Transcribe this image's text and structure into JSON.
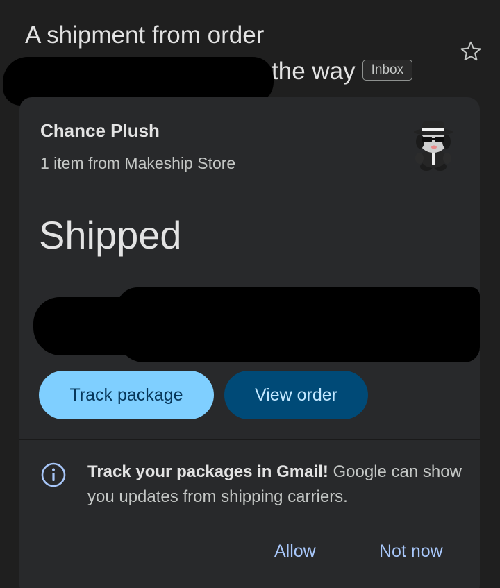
{
  "email": {
    "subject_line1": "A shipment from order",
    "subject_line2": "the way",
    "label_badge": "Inbox"
  },
  "card": {
    "product_name": "Chance Plush",
    "product_sub": "1 item from Makeship Store",
    "status": "Shipped",
    "primary_button": "Track package",
    "secondary_button": "View order"
  },
  "promo": {
    "bold": "Track your packages in Gmail!",
    "text": " Google can show you updates from shipping carriers.",
    "allow": "Allow",
    "not_now": "Not now"
  },
  "icons": {
    "star": "star-outline-icon",
    "info": "info-icon"
  },
  "colors": {
    "background": "#1f1f1f",
    "card": "#28292b",
    "primary_button": "#7fcfff",
    "secondary_button": "#004a77",
    "link": "#a8c7fa"
  }
}
